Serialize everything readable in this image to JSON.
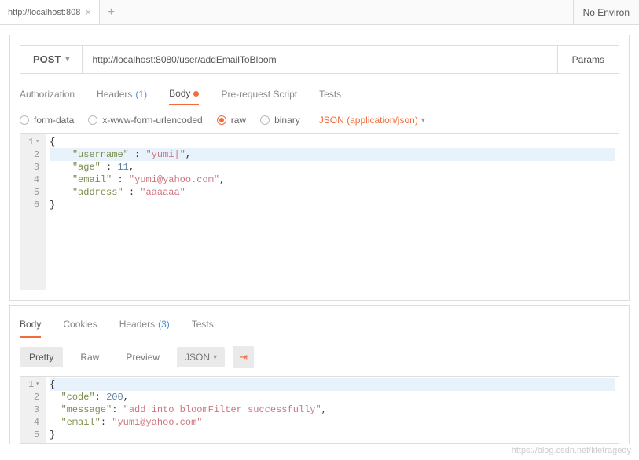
{
  "topbar": {
    "tab_title": "http://localhost:808",
    "env_label": "No Environ"
  },
  "request": {
    "method": "POST",
    "url": "http://localhost:8080/user/addEmailToBloom",
    "params_btn": "Params",
    "tabs": {
      "authorization": "Authorization",
      "headers": "Headers",
      "headers_count": "(1)",
      "body": "Body",
      "prerequest": "Pre-request Script",
      "tests": "Tests"
    },
    "body_types": {
      "form_data": "form-data",
      "urlencoded": "x-www-form-urlencoded",
      "raw": "raw",
      "binary": "binary",
      "content_type": "JSON (application/json)"
    },
    "editor_lines": [
      "1",
      "2",
      "3",
      "4",
      "5",
      "6"
    ],
    "json_body": {
      "l1_open": "{",
      "l2_key": "\"username\"",
      "l2_val": "\"yumi|\"",
      "l3_key": "\"age\"",
      "l3_val": "11",
      "l4_key": "\"email\"",
      "l4_val": "\"yumi@yahoo.com\"",
      "l5_key": "\"address\"",
      "l5_val": "\"aaaaaa\"",
      "l6_close": "}"
    }
  },
  "response": {
    "tabs": {
      "body": "Body",
      "cookies": "Cookies",
      "headers": "Headers",
      "headers_count": "(3)",
      "tests": "Tests"
    },
    "views": {
      "pretty": "Pretty",
      "raw": "Raw",
      "preview": "Preview"
    },
    "format": "JSON",
    "editor_lines": [
      "1",
      "2",
      "3",
      "4",
      "5"
    ],
    "json_body": {
      "l1_open": "{",
      "l2_key": "\"code\"",
      "l2_val": "200",
      "l3_key": "\"message\"",
      "l3_val": "\"add into bloomFilter successfully\"",
      "l4_key": "\"email\"",
      "l4_val": "\"yumi@yahoo.com\"",
      "l5_close": "}"
    }
  },
  "watermark": "https://blog.csdn.net/lifetragedy"
}
